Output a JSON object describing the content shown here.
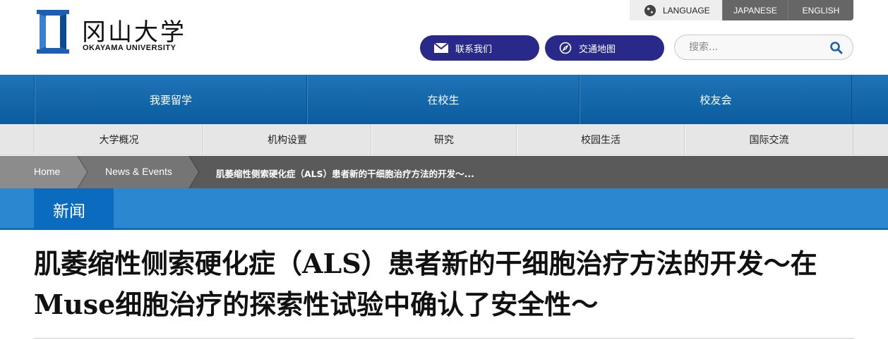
{
  "header": {
    "logo_jp": "冈山大学",
    "logo_en": "OKAYAMA UNIVERSITY",
    "language_label": "LANGUAGE",
    "language_options": [
      "JAPANESE",
      "ENGLISH"
    ],
    "contact_button": "联系我们",
    "map_button": "交通地图",
    "search_placeholder": "搜索...",
    "colors": {
      "pill": "#292989",
      "logo_blue": "#1a5fb4"
    }
  },
  "nav_primary": [
    {
      "label": "我要留学"
    },
    {
      "label": "在校生"
    },
    {
      "label": "校友会"
    }
  ],
  "nav_secondary": [
    {
      "label": "大学概况"
    },
    {
      "label": "机构设置"
    },
    {
      "label": "研究"
    },
    {
      "label": "校园生活"
    },
    {
      "label": "国际交流"
    }
  ],
  "breadcrumb": {
    "home": "Home",
    "section": "News & Events",
    "current": "肌萎缩性侧索硬化症（ALS）患者新的干细胞治疗方法的开发～..."
  },
  "section_tab": "新闻",
  "article": {
    "title": "肌萎缩性侧索硬化症（ALS）患者新的干细胞治疗方法的开发～在Muse细胞治疗的探索性试验中确认了安全性～"
  },
  "icons": [
    "globe-icon",
    "mail-icon",
    "compass-icon",
    "search-icon",
    "logo-icon"
  ]
}
